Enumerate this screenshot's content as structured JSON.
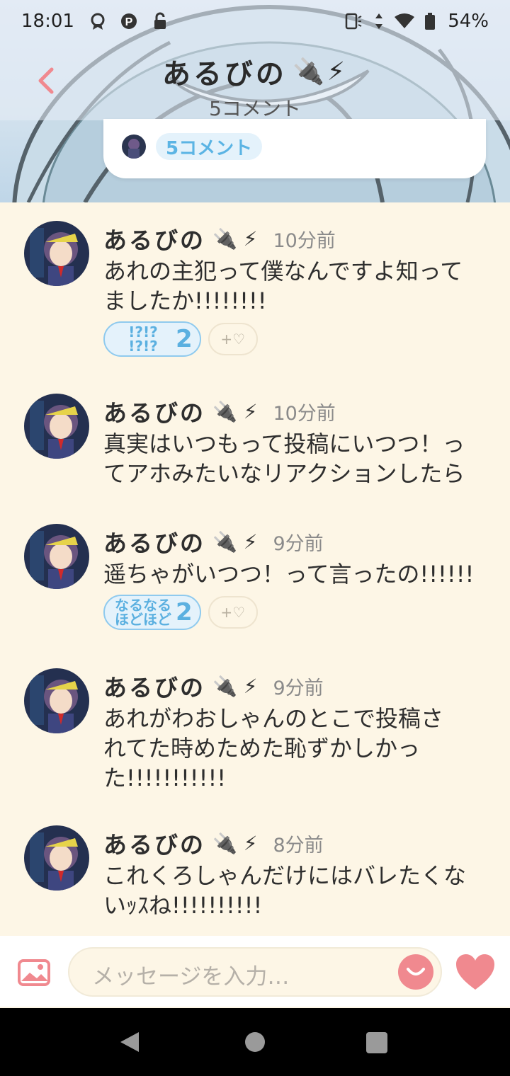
{
  "status_bar": {
    "time": "18:01",
    "battery": "54%"
  },
  "header": {
    "title": "あるびの",
    "title_emoji": "🔌⚡",
    "subtitle": "5コメント",
    "card_count": "5コメント"
  },
  "comments": [
    {
      "name": "あるびの",
      "emoji": "🔌 ⚡",
      "time": "10分前",
      "text": "あれの主犯って僕なんですよ知って\nましたか!!!!!!!!",
      "stamp": {
        "glyph": "!?!?\n!?!?",
        "count": "2"
      }
    },
    {
      "name": "あるびの",
      "emoji": "🔌 ⚡",
      "time": "10分前",
      "text": "真実はいつもって投稿にいつつ！っ\nてアホみたいなリアクションしたら"
    },
    {
      "name": "あるびの",
      "emoji": "🔌 ⚡",
      "time": "9分前",
      "text": "遥ちゃがいつつ！って言ったの!!!!!!",
      "stamp": {
        "glyph": "なるなる\nほどほど",
        "count": "2"
      }
    },
    {
      "name": "あるびの",
      "emoji": "🔌 ⚡",
      "time": "9分前",
      "text": "あれがわおしゃんのとこで投稿さ\nれてた時めためた恥ずかしかっ\nた!!!!!!!!!!!"
    },
    {
      "name": "あるびの",
      "emoji": "🔌 ⚡",
      "time": "8分前",
      "text": "これくろしゃんだけにはバレたくな\nいｯｽね!!!!!!!!!!"
    }
  ],
  "reaction_add": "+♡",
  "input": {
    "placeholder": "メッセージを入力…"
  },
  "colors": {
    "accent_pink": "#f0898f",
    "stamp_blue": "#5bb0e0",
    "background": "#fdf6e6"
  }
}
